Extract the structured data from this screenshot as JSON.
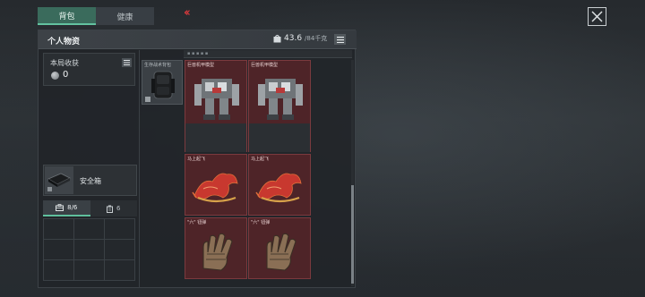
{
  "tabs": [
    {
      "label": "背包"
    },
    {
      "label": "健康"
    }
  ],
  "panel": {
    "title": "个人物资",
    "weight_current": "43.6",
    "weight_max": "/84千克"
  },
  "loot": {
    "label": "本局收获",
    "value": "0"
  },
  "safe_box": {
    "label": "安全箱"
  },
  "sub_tabs": [
    {
      "label": "8/6"
    },
    {
      "label": "6"
    }
  ],
  "backpack": {
    "label": "生存战术背包"
  },
  "items": [
    {
      "name": "巨兽机甲模型"
    },
    {
      "name": "巨兽机甲模型"
    },
    {
      "name": "马上起飞"
    },
    {
      "name": "马上起飞"
    },
    {
      "name": "\"六\" 钮弹"
    },
    {
      "name": "\"六\" 钮弹"
    }
  ],
  "colors": {
    "accent": "#63c2a0",
    "item_bg": "#4e2428",
    "chevron": "#d2393c"
  }
}
